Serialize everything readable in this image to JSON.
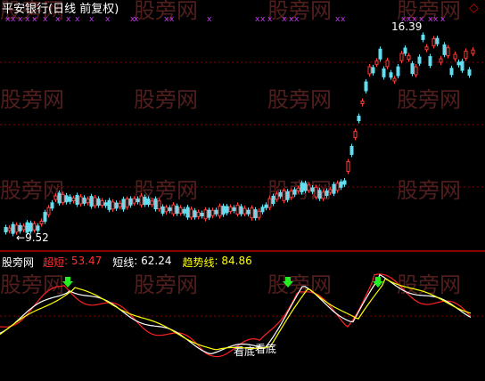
{
  "header": {
    "title": "平安银行(日线 前复权)",
    "title_color": "#ffffff"
  },
  "main_chart": {
    "high_label": "16.39",
    "low_label": "9.52",
    "low_arrow": "←",
    "up_color": "#ff3b3b",
    "down_color": "#5ee0f0",
    "marker_color": "#cc33ff",
    "marker_glyph": "x"
  },
  "indicator": {
    "brand": "股旁网",
    "items": [
      {
        "label": "超短",
        "value": "53.47",
        "color": "#ff3030"
      },
      {
        "label": "短线",
        "value": "62.24",
        "color": "#ffffff"
      },
      {
        "label": "趋势线",
        "value": "84.86",
        "color": "#ffff00"
      }
    ],
    "bottom_labels": [
      "看底",
      "看底"
    ],
    "arrow_color": "#22ee22"
  },
  "watermark": "股旁网",
  "window_icon": "diamond-icon",
  "colors": {
    "background": "#000000",
    "grid": "#8b0000",
    "divider": "#b00000"
  }
}
